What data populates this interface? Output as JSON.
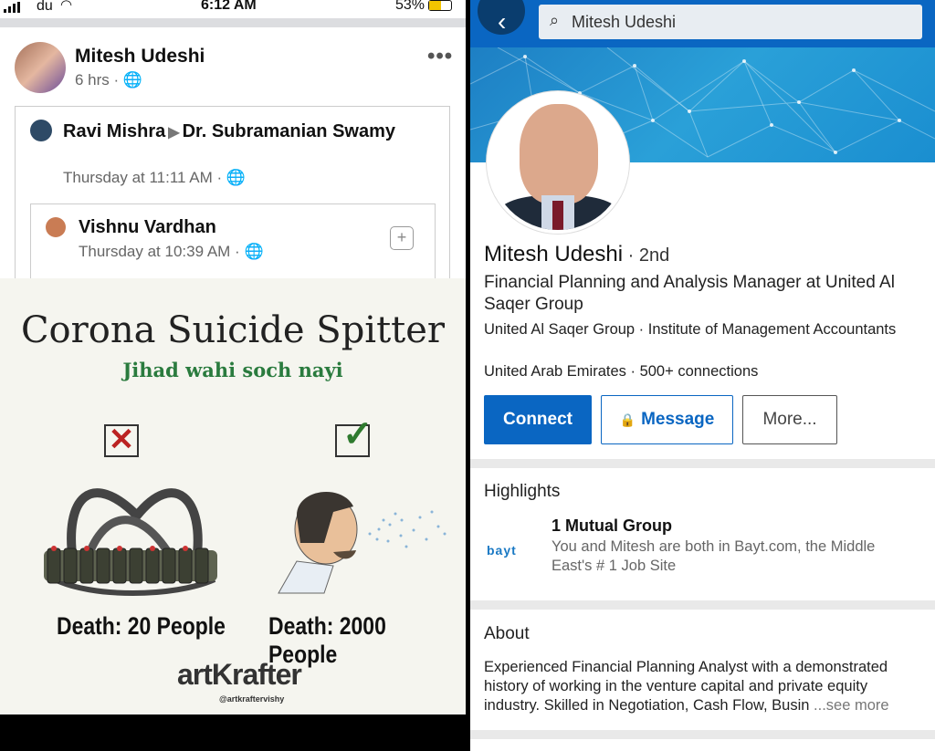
{
  "status_bar": {
    "carrier": "du",
    "time": "6:12 AM",
    "battery": "53%",
    "battery_level": 0.53
  },
  "facebook": {
    "poster_name": "Mitesh Udeshi",
    "post_time": "6 hrs ·",
    "more": "•••",
    "shared": {
      "author": "Ravi Mishra",
      "target": "Dr. Subramanian Swamy",
      "time": "Thursday at 11:11 AM ·"
    },
    "inner": {
      "author": "Vishnu Vardhan",
      "time": "Thursday at 10:39 AM ·"
    },
    "meme": {
      "title": "Corona Suicide Spitter",
      "subtitle": "Jihad wahi soch nayi",
      "left_caption": "Death: 20 People",
      "right_caption": "Death: 2000 People",
      "brand": "artKrafter",
      "handle": "@artkraftervishy"
    }
  },
  "linkedin": {
    "search_value": "Mitesh Udeshi",
    "name": "Mitesh Udeshi",
    "degree": " · 2nd",
    "headline": "Financial Planning and Analysis Manager at United Al Saqer Group",
    "companies": "United Al Saqer Group · Institute of Management Accountants",
    "location": "United Arab Emirates · 500+ connections",
    "buttons": {
      "connect": "Connect",
      "message": "Message",
      "more": "More..."
    },
    "highlights": {
      "title": "Highlights",
      "logo_text": "bayt",
      "item_title": "1 Mutual Group",
      "item_desc": "You and Mitesh are both in Bayt.com, the Middle East's # 1 Job Site"
    },
    "about": {
      "title": "About",
      "text": "Experienced Financial Planning Analyst with a demonstrated history of working in the venture capital and private equity industry. Skilled in Negotiation, Cash Flow, Busin",
      "see_more": " ...see more"
    }
  }
}
